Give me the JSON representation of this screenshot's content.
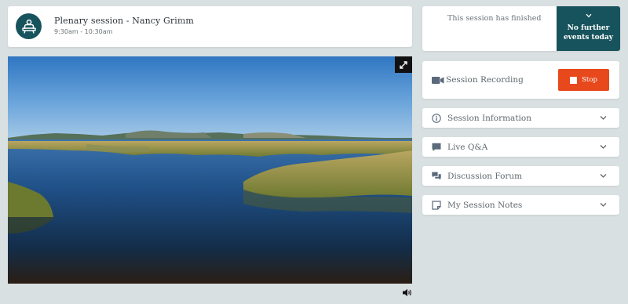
{
  "session": {
    "title": "Plenary session - Nancy Grimm",
    "time": "9:30am - 10:30am",
    "favorite_icon": "star-outline-icon",
    "avatar_icon": "presenter-at-podium-icon"
  },
  "video": {
    "expand_icon": "expand-arrows-icon",
    "volume_icon": "speaker-volume-icon"
  },
  "status": {
    "message": "This session has finished",
    "next_line1": "No further",
    "next_line2": "events today",
    "chevron_icon": "chevron-down-icon"
  },
  "recording": {
    "label": "Session Recording",
    "stop_label": "Stop",
    "icon": "video-camera-icon"
  },
  "accordion": [
    {
      "label": "Session Information",
      "icon": "info-circle-icon"
    },
    {
      "label": "Live Q&A",
      "icon": "speech-bubble-icon"
    },
    {
      "label": "Discussion Forum",
      "icon": "chat-bubbles-icon"
    },
    {
      "label": "My Session Notes",
      "icon": "note-icon"
    }
  ],
  "colors": {
    "background": "#d9e0e1",
    "brand_teal": "#17535c",
    "stop_red": "#e7481c"
  }
}
